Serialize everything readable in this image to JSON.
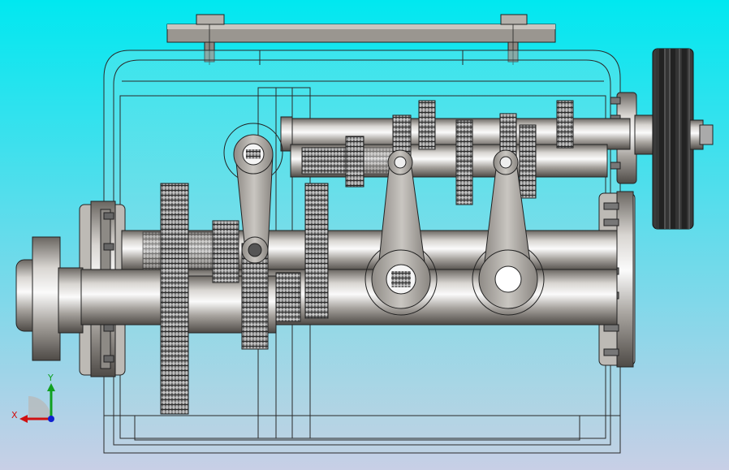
{
  "viewport": {
    "background_top": "#00e8f0",
    "background_bottom": "#c8cfe6"
  },
  "model": {
    "steel_light": "#f2f2f2",
    "steel_mid": "#a9a5a0",
    "steel_dark": "#5c5853",
    "gear_dark": "#3a3a3a",
    "edge_color": "#1c1c1c",
    "housing_tint": "#7fd8dc"
  },
  "triad": {
    "x_label": "X",
    "y_label": "Y",
    "x_color": "#d01010",
    "y_color": "#10a020",
    "z_color": "#1020d0"
  }
}
